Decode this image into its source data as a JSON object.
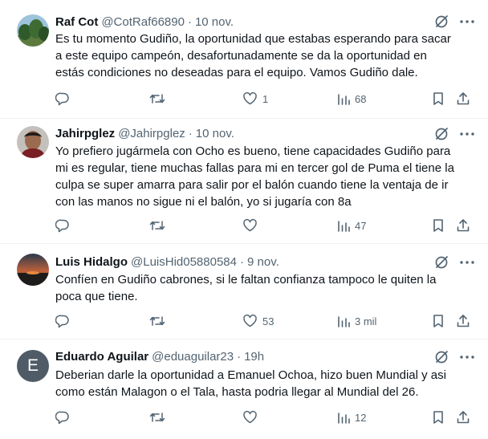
{
  "tweets": [
    {
      "name": "Raf Cot",
      "handle": "@CotRaf66890",
      "separator": "·",
      "time": "10 nov.",
      "text": "Es tu momento Gudiño, la oportunidad que estabas esperando para sacar\na este equipo campeón, desafortunadamente se da la oportunidad en\nestás condiciones no deseadas para el equipo. Vamos Gudiño dale.",
      "replies": "",
      "retweets": "",
      "likes": "1",
      "views": "68",
      "avatar": "photo-trees"
    },
    {
      "name": "Jahirpglez",
      "handle": "@Jahirpglez",
      "separator": "·",
      "time": "10 nov.",
      "text": "Yo prefiero jugármela con Ocho es bueno, tiene capacidades Gudiño para\nmi es regular, tiene muchas fallas para mi en tercer gol de Puma el tiene la\nculpa se super amarra para salir por el balón cuando tiene la ventaja de ir\ncon las manos no sigue ni el balón, yo si jugaría con 8a",
      "replies": "",
      "retweets": "",
      "likes": "",
      "views": "47",
      "avatar": "photo-person"
    },
    {
      "name": "Luis Hidalgo",
      "handle": "@LuisHid05880584",
      "separator": "·",
      "time": "9 nov.",
      "text": "Confíen en Gudiño cabrones, si le faltan confianza tampoco le quiten la\npoca que tiene.",
      "replies": "",
      "retweets": "",
      "likes": "53",
      "views": "3 mil",
      "avatar": "photo-sunset"
    },
    {
      "name": "Eduardo Aguilar",
      "handle": "@eduaguilar23",
      "separator": "·",
      "time": "19h",
      "text": "Deberian darle la oportunidad a Emanuel Ochoa, hizo buen Mundial y asi\ncomo están Malagon o el Tala, hasta podria llegar al Mundial del 26.",
      "replies": "",
      "retweets": "",
      "likes": "",
      "views": "12",
      "avatar": "letter",
      "avatar_letter": "E"
    }
  ],
  "icons": {
    "reply": "reply-icon",
    "retweet": "retweet-icon",
    "like": "heart-icon",
    "views": "views-icon",
    "bookmark": "bookmark-icon",
    "share": "share-icon",
    "grok": "grok-icon",
    "more": "more-icon"
  },
  "colors": {
    "text": "#0f1419",
    "secondary": "#536471",
    "divider": "#eff3f4",
    "avatar_letter_bg": "#4f5b66"
  }
}
